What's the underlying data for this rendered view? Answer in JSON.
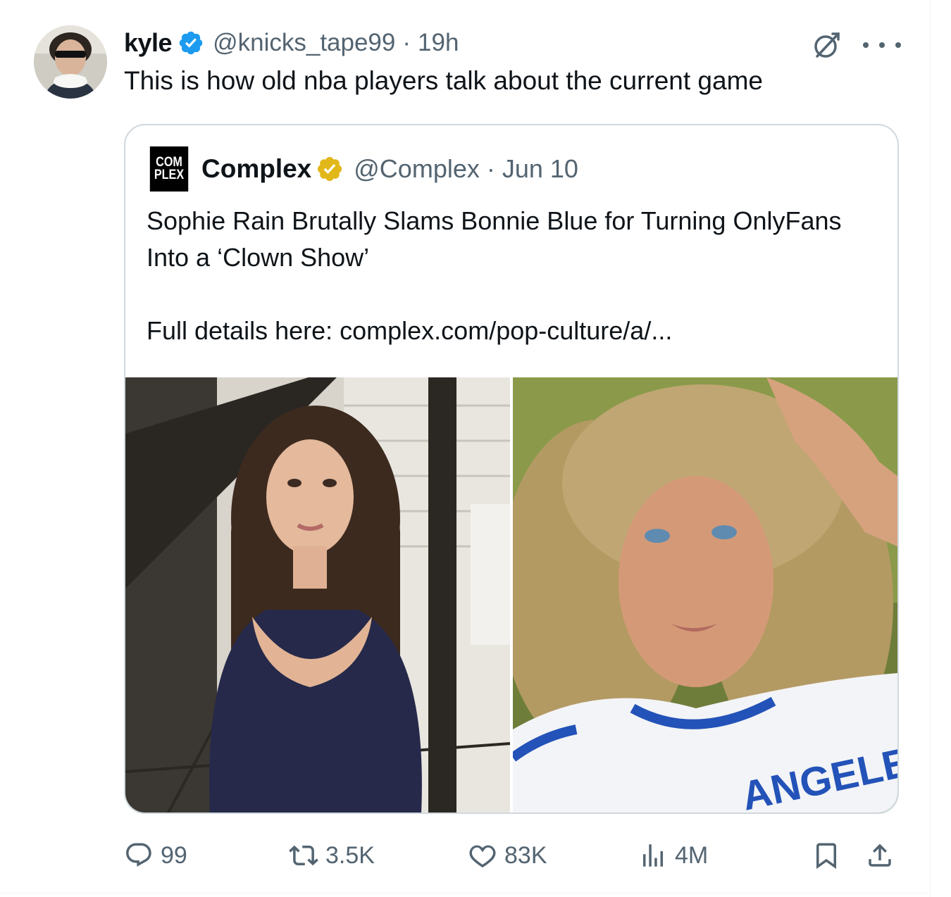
{
  "tweet": {
    "author_name": "kyle",
    "author_handle": "@knicks_tape99",
    "separator": "·",
    "time": "19h",
    "text": "This is how old nba players talk about the current game"
  },
  "quoted": {
    "logo_line1": "COM",
    "logo_line2": "PLEX",
    "author_name": "Complex",
    "author_handle": "@Complex",
    "separator": "·",
    "date": "Jun 10",
    "text_line1": "Sophie Rain Brutally Slams Bonnie Blue for Turning OnlyFans Into a ‘Clown Show’",
    "text_link": "Full details here: complex.com/pop-culture/a/...",
    "photo_right_shirt_text": "ANGELES"
  },
  "actions": {
    "replies": "99",
    "reposts": "3.5K",
    "likes": "83K",
    "views": "4M"
  },
  "colors": {
    "text": "#0f1419",
    "secondary": "#536471",
    "verified_blue": "#1d9bf0",
    "verified_gold": "#e2b719",
    "border": "#cfd9de"
  }
}
